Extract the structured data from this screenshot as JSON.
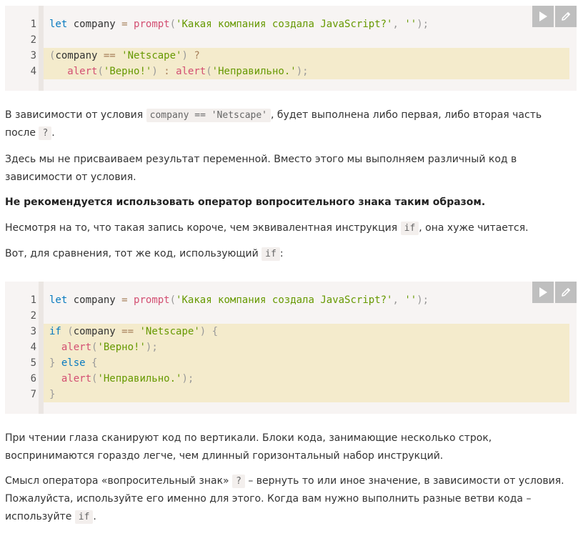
{
  "code_block_1": {
    "lines": [
      {
        "num": "1",
        "highlight": false,
        "tokens": [
          [
            "kw",
            "let"
          ],
          [
            "pl",
            " company "
          ],
          [
            "op",
            "="
          ],
          [
            "pl",
            " "
          ],
          [
            "fn",
            "prompt"
          ],
          [
            "pn",
            "("
          ],
          [
            "str",
            "'Какая компания создала JavaScript?'"
          ],
          [
            "pn",
            ", "
          ],
          [
            "str",
            "''"
          ],
          [
            "pn",
            ");"
          ]
        ]
      },
      {
        "num": "2",
        "highlight": false,
        "tokens": []
      },
      {
        "num": "3",
        "highlight": true,
        "tokens": [
          [
            "pn",
            "("
          ],
          [
            "pl",
            "company "
          ],
          [
            "op",
            "=="
          ],
          [
            "pl",
            " "
          ],
          [
            "str",
            "'Netscape'"
          ],
          [
            "pn",
            ")"
          ],
          [
            "pl",
            " "
          ],
          [
            "op",
            "?"
          ]
        ]
      },
      {
        "num": "4",
        "highlight": true,
        "tokens": [
          [
            "pl",
            "   "
          ],
          [
            "fn",
            "alert"
          ],
          [
            "pn",
            "("
          ],
          [
            "str",
            "'Верно!'"
          ],
          [
            "pn",
            ")"
          ],
          [
            "pl",
            " "
          ],
          [
            "op",
            ":"
          ],
          [
            "pl",
            " "
          ],
          [
            "fn",
            "alert"
          ],
          [
            "pn",
            "("
          ],
          [
            "str",
            "'Неправильно.'"
          ],
          [
            "pn",
            ");"
          ]
        ]
      }
    ]
  },
  "code_block_2": {
    "lines": [
      {
        "num": "1",
        "highlight": false,
        "tokens": [
          [
            "kw",
            "let"
          ],
          [
            "pl",
            " company "
          ],
          [
            "op",
            "="
          ],
          [
            "pl",
            " "
          ],
          [
            "fn",
            "prompt"
          ],
          [
            "pn",
            "("
          ],
          [
            "str",
            "'Какая компания создала JavaScript?'"
          ],
          [
            "pn",
            ", "
          ],
          [
            "str",
            "''"
          ],
          [
            "pn",
            ");"
          ]
        ]
      },
      {
        "num": "2",
        "highlight": false,
        "tokens": []
      },
      {
        "num": "3",
        "highlight": true,
        "tokens": [
          [
            "kw",
            "if"
          ],
          [
            "pl",
            " "
          ],
          [
            "pn",
            "("
          ],
          [
            "pl",
            "company "
          ],
          [
            "op",
            "=="
          ],
          [
            "pl",
            " "
          ],
          [
            "str",
            "'Netscape'"
          ],
          [
            "pn",
            ")"
          ],
          [
            "pl",
            " "
          ],
          [
            "pn",
            "{"
          ]
        ]
      },
      {
        "num": "4",
        "highlight": true,
        "tokens": [
          [
            "pl",
            "  "
          ],
          [
            "fn",
            "alert"
          ],
          [
            "pn",
            "("
          ],
          [
            "str",
            "'Верно!'"
          ],
          [
            "pn",
            ");"
          ]
        ]
      },
      {
        "num": "5",
        "highlight": true,
        "tokens": [
          [
            "pn",
            "}"
          ],
          [
            "pl",
            " "
          ],
          [
            "kw",
            "else"
          ],
          [
            "pl",
            " "
          ],
          [
            "pn",
            "{"
          ]
        ]
      },
      {
        "num": "6",
        "highlight": true,
        "tokens": [
          [
            "pl",
            "  "
          ],
          [
            "fn",
            "alert"
          ],
          [
            "pn",
            "("
          ],
          [
            "str",
            "'Неправильно.'"
          ],
          [
            "pn",
            ");"
          ]
        ]
      },
      {
        "num": "7",
        "highlight": true,
        "tokens": [
          [
            "pn",
            "}"
          ]
        ]
      }
    ]
  },
  "toolbar": {
    "run_icon": "play-icon",
    "edit_icon": "pencil-icon"
  },
  "p1": {
    "a": "В зависимости от условия ",
    "code": "company == 'Netscape'",
    "b": ", будет выполнена либо первая, либо вторая часть",
    "c": "после ",
    "code2": "?",
    "d": "."
  },
  "p2": {
    "line1": "Здесь мы не присваиваем результат переменной. Вместо этого мы выполняем различный код в",
    "line2": "зависимости от условия."
  },
  "p3": {
    "text": "Не рекомендуется использовать оператор вопросительного знака таким образом."
  },
  "p4": {
    "a": "Несмотря на то, что такая запись короче, чем эквивалентная инструкция ",
    "code": "if",
    "b": ", она хуже читается."
  },
  "p5": {
    "a": "Вот, для сравнения, тот же код, использующий ",
    "code": "if",
    "b": ":"
  },
  "p6": {
    "line1": "При чтении глаза сканируют код по вертикали. Блоки кода, занимающие несколько строк,",
    "line2": "воспринимаются гораздо легче, чем длинный горизонтальный набор инструкций."
  },
  "p7": {
    "a": "Смысл оператора «вопросительный знак» ",
    "code": "?",
    "b": " – вернуть то или иное значение, в зависимости от условия.",
    "line2": "Пожалуйста, используйте его именно для этого. Когда вам нужно выполнить разные ветви кода –",
    "c": "используйте ",
    "code2": "if",
    "d": "."
  }
}
